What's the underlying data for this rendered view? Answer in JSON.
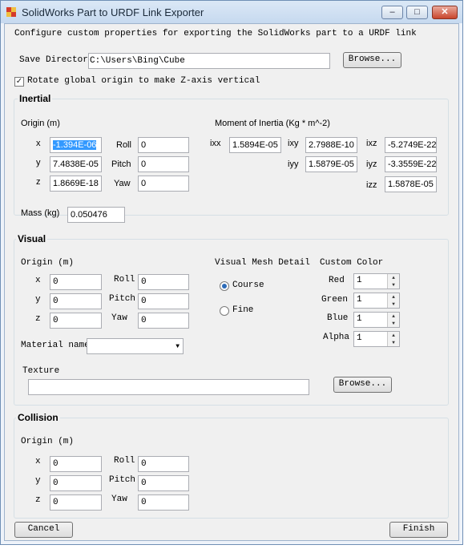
{
  "window": {
    "title": "SolidWorks Part to URDF Link Exporter",
    "controls": {
      "minimize": "–",
      "maximize": "□",
      "close": "✕"
    }
  },
  "header": {
    "instruction": "Configure custom properties for exporting the SolidWorks part to a URDF link",
    "save_directory_label": "Save Directory",
    "save_directory_value": "C:\\Users\\Bing\\Cube",
    "browse_label": "Browse...",
    "rotate_checkbox_label": "Rotate global origin to make Z-axis vertical",
    "rotate_checked": "✓"
  },
  "inertial": {
    "title": "Inertial",
    "origin_label": "Origin (m)",
    "x_label": "x",
    "x_value": "-1.394E-06",
    "y_label": "y",
    "y_value": "7.4838E-05",
    "z_label": "z",
    "z_value": "1.8669E-18",
    "roll_label": "Roll",
    "roll_value": "0",
    "pitch_label": "Pitch",
    "pitch_value": "0",
    "yaw_label": "Yaw",
    "yaw_value": "0",
    "moi_label": "Moment of Inertia (Kg * m^-2)",
    "ixx_label": "ixx",
    "ixx_value": "1.5894E-05",
    "ixy_label": "ixy",
    "ixy_value": "2.7988E-10",
    "ixz_label": "ixz",
    "ixz_value": "-5.2749E-22",
    "iyy_label": "iyy",
    "iyy_value": "1.5879E-05",
    "iyz_label": "iyz",
    "iyz_value": "-3.3559E-22",
    "izz_label": "izz",
    "izz_value": "1.5878E-05",
    "mass_label": "Mass (kg)",
    "mass_value": "0.050476"
  },
  "visual": {
    "title": "Visual",
    "origin_label": "Origin (m)",
    "x_label": "x",
    "x_value": "0",
    "y_label": "y",
    "y_value": "0",
    "z_label": "z",
    "z_value": "0",
    "roll_label": "Roll",
    "roll_value": "0",
    "pitch_label": "Pitch",
    "pitch_value": "0",
    "yaw_label": "Yaw",
    "yaw_value": "0",
    "mesh_detail_label": "Visual Mesh Detail",
    "course_label": "Course",
    "fine_label": "Fine",
    "custom_color_label": "Custom Color",
    "red_label": "Red",
    "red_value": "1",
    "green_label": "Green",
    "green_value": "1",
    "blue_label": "Blue",
    "blue_value": "1",
    "alpha_label": "Alpha",
    "alpha_value": "1",
    "material_label": "Material name",
    "material_value": "",
    "texture_label": "Texture",
    "texture_value": "",
    "browse_label": "Browse..."
  },
  "collision": {
    "title": "Collision",
    "origin_label": "Origin (m)",
    "x_label": "x",
    "x_value": "0",
    "y_label": "y",
    "y_value": "0",
    "z_label": "z",
    "z_value": "0",
    "roll_label": "Roll",
    "roll_value": "0",
    "pitch_label": "Pitch",
    "pitch_value": "0",
    "yaw_label": "Yaw",
    "yaw_value": "0"
  },
  "footer": {
    "cancel_label": "Cancel",
    "finish_label": "Finish"
  },
  "icons": {
    "app_icon": "solidworks-icon",
    "dropdown_arrow": "▼",
    "spin_up": "▲",
    "spin_down": "▼"
  },
  "colors": {
    "selection_highlight": "#3399ff",
    "title_bar": "#c6d9ef",
    "close_button": "#c9452c"
  }
}
